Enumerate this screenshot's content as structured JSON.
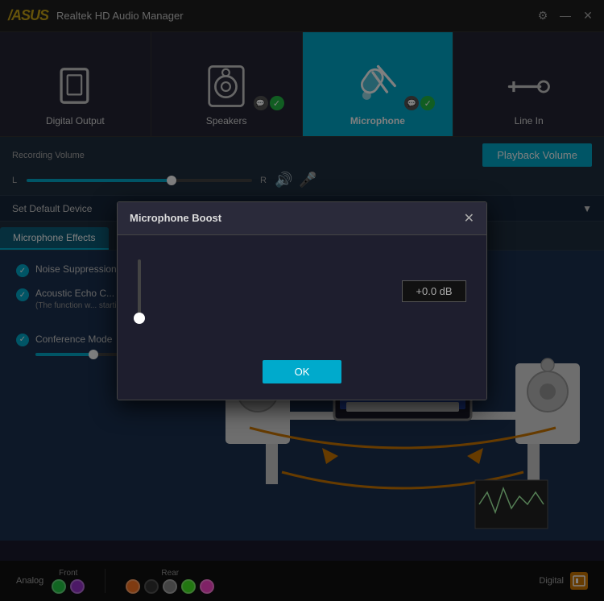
{
  "app": {
    "title": "Realtek HD Audio Manager",
    "logo": "/ASUS",
    "controls": {
      "settings": "⚙",
      "minimize": "—",
      "close": "✕"
    }
  },
  "devices": [
    {
      "id": "digital-output",
      "label": "Digital Output",
      "active": false,
      "has_badge": false
    },
    {
      "id": "speakers",
      "label": "Speakers",
      "active": false,
      "has_badge": true
    },
    {
      "id": "microphone",
      "label": "Microphone",
      "active": true,
      "has_badge": true
    },
    {
      "id": "line-in",
      "label": "Line In",
      "active": false,
      "has_badge": false
    }
  ],
  "recording_volume": {
    "label": "Recording Volume",
    "left": "L",
    "right": "R",
    "fill_percent": 65
  },
  "playback_volume_btn": "Playback Volume",
  "set_default_device": "Set Default Device",
  "tabs": [
    {
      "id": "microphone-effects",
      "label": "Microphone Effects"
    }
  ],
  "effects": [
    {
      "id": "noise-suppression",
      "label": "Noise Suppression",
      "enabled": true
    },
    {
      "id": "acoustic-echo",
      "label": "Acoustic Echo C...",
      "sub": "(The function w... starting from t...",
      "enabled": true
    }
  ],
  "conference_mode": {
    "label": "Conference Mode",
    "enabled": true,
    "slider_percent": 60
  },
  "modal": {
    "title": "Microphone Boost",
    "close_label": "✕",
    "db_value": "+0.0 dB",
    "ok_label": "OK"
  },
  "bottom_bar": {
    "analog_label": "Analog",
    "front_label": "Front",
    "rear_label": "Rear",
    "digital_label": "Digital",
    "front_connectors": [
      "conn-green",
      "conn-purple"
    ],
    "rear_connectors": [
      "conn-orange",
      "conn-black",
      "conn-gray",
      "conn-green2",
      "conn-pink"
    ]
  }
}
